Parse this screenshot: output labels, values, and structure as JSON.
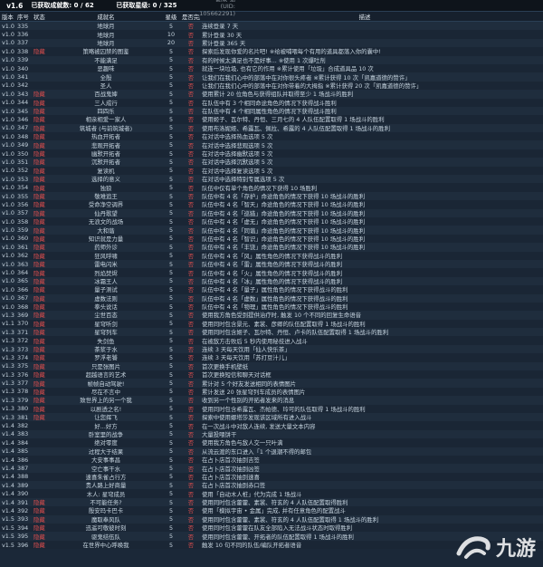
{
  "topbar": {
    "version": "v1.6",
    "achievements_label": "已获取成就数: 0 / 62",
    "stars_label": "已获取星级: 0 / 325",
    "uid": "翻录 猫 (UID: 105662291)"
  },
  "columns": [
    "版本",
    "序号",
    "状态",
    "成就名",
    "星级",
    "是否完成",
    "描述"
  ],
  "rows": [
    {
      "v": "v1.0",
      "n": "335",
      "s": "",
      "name": "地球月",
      "star": "5",
      "done": "否",
      "desc": "连续登录 7 天"
    },
    {
      "v": "v1.0",
      "n": "336",
      "s": "",
      "name": "地球月",
      "star": "10",
      "done": "否",
      "desc": "累计登录 30 天"
    },
    {
      "v": "v1.0",
      "n": "337",
      "s": "",
      "name": "地球月",
      "star": "20",
      "done": "否",
      "desc": "累计登录 365 天"
    },
    {
      "v": "v1.0",
      "n": "338",
      "s": "隐藏",
      "name": "策略被囚禁的图鉴",
      "star": "5",
      "done": "否",
      "desc": "探索后发现你爱的名片吧! ※给被哺喂每个有用的道具都落入你的囊中!"
    },
    {
      "v": "v1.0",
      "n": "339",
      "s": "",
      "name": "不能满足",
      "star": "5",
      "done": "否",
      "desc": "有的时候太满足也不是好事... ※使用 1 次爆吐剂"
    },
    {
      "v": "v1.0",
      "n": "340",
      "s": "",
      "name": "恶趣味",
      "star": "5",
      "done": "否",
      "desc": "就连一块垃圾, 也有它的作用 ※累计使用「垃圾」合成道具品 10 次"
    },
    {
      "v": "v1.0",
      "n": "341",
      "s": "",
      "name": "全殷",
      "star": "5",
      "done": "否",
      "desc": "让我们在我们心中的部落中在对你很头疼者 ※累计获得 10 次「凯嘉道德的赞许」"
    },
    {
      "v": "v1.0",
      "n": "342",
      "s": "",
      "name": "圣人",
      "star": "5",
      "done": "否",
      "desc": "让我们在我们心中的部落中在对你带着的大拇指 ※累计获得 20 次「凯嘉道德的赞许」"
    },
    {
      "v": "v1.0",
      "n": "343",
      "s": "隐藏",
      "name": "百战鬼婶",
      "star": "5",
      "done": "否",
      "desc": "使用累计 20 位角色与获得组队并取得至少 1 场战斗的胜利"
    },
    {
      "v": "v1.0",
      "n": "344",
      "s": "隐藏",
      "name": "三人成行",
      "star": "5",
      "done": "否",
      "desc": "在队伍中有 3 个相同命途角色的情况下获得战斗胜利"
    },
    {
      "v": "v1.0",
      "n": "345",
      "s": "隐藏",
      "name": "四四乐",
      "star": "5",
      "done": "否",
      "desc": "在队伍中有 4 个相同属性角色的情况下获得战斗胜利"
    },
    {
      "v": "v1.0",
      "n": "346",
      "s": "隐藏",
      "name": "相亲相爱一家人",
      "star": "5",
      "done": "否",
      "desc": "使用姬子、瓦尔特、丹恒、三月七的 4 人队伍配置取得 1 场战斗的胜利"
    },
    {
      "v": "v1.0",
      "n": "347",
      "s": "隐藏",
      "name": "筑城者 (与前筑城者)",
      "star": "5",
      "done": "否",
      "desc": "使用布洛妮娅、希露瓦、佩拉、希露的 4 人队伍配置取得 1 场战斗的胜利"
    },
    {
      "v": "v1.0",
      "n": "348",
      "s": "隐藏",
      "name": "热血开拓者",
      "star": "5",
      "done": "否",
      "desc": "在对话中选择热血选项 5 次"
    },
    {
      "v": "v1.0",
      "n": "349",
      "s": "隐藏",
      "name": "悲观开拓者",
      "star": "5",
      "done": "否",
      "desc": "在对话中选择悲观选项 5 次"
    },
    {
      "v": "v1.0",
      "n": "350",
      "s": "隐藏",
      "name": "幽默开拓者",
      "star": "5",
      "done": "否",
      "desc": "在对话中选择幽默选项 5 次"
    },
    {
      "v": "v1.0",
      "n": "351",
      "s": "隐藏",
      "name": "沉默开拓者",
      "star": "5",
      "done": "否",
      "desc": "在对话中选择沉默选项 5 次"
    },
    {
      "v": "v1.0",
      "n": "352",
      "s": "隐藏",
      "name": "复读机",
      "star": "5",
      "done": "否",
      "desc": "在对话中选择复读选项 5 次"
    },
    {
      "v": "v1.0",
      "n": "353",
      "s": "隐藏",
      "name": "选择的意义",
      "star": "5",
      "done": "否",
      "desc": "在对话中选择特别专属选项 5 次"
    },
    {
      "v": "v1.0",
      "n": "354",
      "s": "隐藏",
      "name": "独狼",
      "star": "5",
      "done": "否",
      "desc": "队伍中仅有单个角色的情况下获得 10 场胜利"
    },
    {
      "v": "v1.0",
      "n": "355",
      "s": "隐藏",
      "name": "敬难追王",
      "star": "5",
      "done": "否",
      "desc": "队伍中有 4 名「存护」命途角色的情况下获得 10 场战斗的胜利"
    },
    {
      "v": "v1.0",
      "n": "356",
      "s": "隐藏",
      "name": "受命净空调界",
      "star": "5",
      "done": "否",
      "desc": "队伍中有 4 名「智天」命途角色的情况下获得 10 场战斗的胜利"
    },
    {
      "v": "v1.0",
      "n": "357",
      "s": "隐藏",
      "name": "仙丹歌望",
      "star": "5",
      "done": "否",
      "desc": "队伍中有 4 名「巡猎」命途角色的情况下获得 10 场战斗的胜利"
    },
    {
      "v": "v1.0",
      "n": "358",
      "s": "隐藏",
      "name": "无浪文的战场",
      "star": "5",
      "done": "否",
      "desc": "队伍中有 4 名「虚无」命途角色的情况下获得 10 场战斗的胜利"
    },
    {
      "v": "v1.0",
      "n": "359",
      "s": "隐藏",
      "name": "大和谐",
      "star": "5",
      "done": "否",
      "desc": "队伍中有 4 名「同谐」命途角色的情况下获得 10 场战斗的胜利"
    },
    {
      "v": "v1.0",
      "n": "360",
      "s": "隐藏",
      "name": "知识就是力量",
      "star": "5",
      "done": "否",
      "desc": "队伍中有 4 名「智识」命途角色的情况下获得 10 场战斗的胜利"
    },
    {
      "v": "v1.0",
      "n": "361",
      "s": "隐藏",
      "name": "药师外诊",
      "star": "5",
      "done": "否",
      "desc": "队伍中有 4 名「丰饶」命途角色的情况下获得 10 场战斗的胜利"
    },
    {
      "v": "v1.0",
      "n": "362",
      "s": "隐藏",
      "name": "狂风呼啸",
      "star": "5",
      "done": "否",
      "desc": "队伍中有 4 名「风」属性角色的情况下获得战斗的胜利"
    },
    {
      "v": "v1.0",
      "n": "363",
      "s": "隐藏",
      "name": "雷电闪米",
      "star": "5",
      "done": "否",
      "desc": "队伍中有 4 名「雷」属性角色的情况下获得战斗的胜利"
    },
    {
      "v": "v1.0",
      "n": "364",
      "s": "隐藏",
      "name": "烈焰焚烬",
      "star": "5",
      "done": "否",
      "desc": "队伍中有 4 名「火」属性角色的情况下获得战斗的胜利"
    },
    {
      "v": "v1.0",
      "n": "365",
      "s": "隐藏",
      "name": "冰霜王人",
      "star": "5",
      "done": "否",
      "desc": "队伍中有 4 名「冰」属性角色的情况下获得战斗的胜利"
    },
    {
      "v": "v1.0",
      "n": "366",
      "s": "隐藏",
      "name": "量子测试",
      "star": "5",
      "done": "否",
      "desc": "队伍中有 4 名「量子」属性角色的情况下获得战斗的胜利"
    },
    {
      "v": "v1.0",
      "n": "367",
      "s": "隐藏",
      "name": "虚数法则",
      "star": "5",
      "done": "否",
      "desc": "队伍中有 4 名「虚数」属性角色的情况下获得战斗的胜利"
    },
    {
      "v": "v1.0",
      "n": "368",
      "s": "隐藏",
      "name": "拳头说话",
      "star": "5",
      "done": "否",
      "desc": "队伍中有 4 名「物理」属性角色的情况下获得战斗的胜利"
    },
    {
      "v": "v1.3",
      "n": "369",
      "s": "隐藏",
      "name": "尘世百态",
      "star": "5",
      "done": "否",
      "desc": "使用我方角色受到提供治疗时, 触发 10 个不同的回复生命语音"
    },
    {
      "v": "v1.1",
      "n": "370",
      "s": "隐藏",
      "name": "星穹听剑",
      "star": "5",
      "done": "否",
      "desc": "使用同时包含景元、素裳、彦卿的队伍配置取得 1 场战斗的胜利"
    },
    {
      "v": "v1.3",
      "n": "371",
      "s": "隐藏",
      "name": "星穹列车",
      "star": "5",
      "done": "否",
      "desc": "使用同时包含姬子、瓦尔特、丹恒、卢卡的队伍配置取得 1 场战斗的胜利"
    },
    {
      "v": "v1.3",
      "n": "372",
      "s": "隐藏",
      "name": "失剑鱼",
      "star": "5",
      "done": "否",
      "desc": "在被敌方击败后 5 秒内使用秘技进入战斗"
    },
    {
      "v": "v1.3",
      "n": "373",
      "s": "隐藏",
      "name": "茶浆于水",
      "star": "5",
      "done": "否",
      "desc": "连续 3 天每天饮用「仙人快乐茶」"
    },
    {
      "v": "v1.3",
      "n": "374",
      "s": "隐藏",
      "name": "罗浮老饕",
      "star": "5",
      "done": "否",
      "desc": "连续 3 天每天饮用「苏打豆汁儿」"
    },
    {
      "v": "v1.3",
      "n": "375",
      "s": "隐藏",
      "name": "只是张图片",
      "star": "5",
      "done": "否",
      "desc": "首次更换手机壁纸"
    },
    {
      "v": "v1.3",
      "n": "376",
      "s": "隐藏",
      "name": "超越语言的艺术",
      "star": "5",
      "done": "否",
      "desc": "首次更换短信和聊天对话框"
    },
    {
      "v": "v1.3",
      "n": "377",
      "s": "隐藏",
      "name": "帧帧自动驾驶!",
      "star": "5",
      "done": "否",
      "desc": "累计对 5 个好友发送相同的表情图片"
    },
    {
      "v": "v1.3",
      "n": "378",
      "s": "隐藏",
      "name": "尽在不言中",
      "star": "5",
      "done": "否",
      "desc": "累计发送 20 张星穹列车成员的表情图片"
    },
    {
      "v": "v1.3",
      "n": "379",
      "s": "隐藏",
      "name": "致世界上的另一个我",
      "star": "5",
      "done": "否",
      "desc": "收到另一个性别的开拓者发来的消息"
    },
    {
      "v": "v1.3",
      "n": "380",
      "s": "隐藏",
      "name": "以剧透之名!",
      "star": "5",
      "done": "否",
      "desc": "使用同时包含希露瓦、杰帕德、玲可的队伍取得 1 场战斗的胜利"
    },
    {
      "v": "v1.3",
      "n": "381",
      "s": "隐藏",
      "name": "让您挥飞",
      "star": "5",
      "done": "否",
      "desc": "探索中使用娜塔莎发现该区域所有进入战斗"
    },
    {
      "v": "v1.4",
      "n": "382",
      "s": "",
      "name": "好...好方",
      "star": "5",
      "done": "否",
      "desc": "在一次战斗中对敌人连续, 发送大量文本内容"
    },
    {
      "v": "v1.4",
      "n": "383",
      "s": "",
      "name": "卧室里的战争",
      "star": "5",
      "done": "否",
      "desc": "大量投喂饼干"
    },
    {
      "v": "v1.4",
      "n": "384",
      "s": "",
      "name": "绝对零度",
      "star": "5",
      "done": "否",
      "desc": "使用我方角色与敌人交一只叶满"
    },
    {
      "v": "v1.4",
      "n": "385",
      "s": "",
      "name": "过程大于结果",
      "star": "5",
      "done": "否",
      "desc": "从流云渡的东口进入「1 个退潮不得的邮包"
    },
    {
      "v": "v1.4",
      "n": "386",
      "s": "",
      "name": "大安事事昌",
      "star": "5",
      "done": "否",
      "desc": "在占卜店首次抽到吉签"
    },
    {
      "v": "v1.4",
      "n": "387",
      "s": "",
      "name": "空亡事干水",
      "star": "5",
      "done": "否",
      "desc": "在占卜店首次抽到凶签"
    },
    {
      "v": "v1.4",
      "n": "388",
      "s": "",
      "name": "速喜朱雀占行方",
      "star": "5",
      "done": "否",
      "desc": "在占卜店首次抽到速喜"
    },
    {
      "v": "v1.4",
      "n": "389",
      "s": "",
      "name": "贵人路上好商量",
      "star": "5",
      "done": "否",
      "desc": "在占卜店首次抽到赤口签"
    },
    {
      "v": "v1.4",
      "n": "390",
      "s": "",
      "name": "木人: 星穹成员",
      "star": "5",
      "done": "否",
      "desc": "使用「自动木人桩」代为完成 1 场战斗"
    },
    {
      "v": "v1.4",
      "n": "391",
      "s": "隐藏",
      "name": "不可能任务?",
      "star": "5",
      "done": "否",
      "desc": "使用同时包含藿藿、素裳、符玄的 4 人队伍配置取得胜利"
    },
    {
      "v": "v1.4",
      "n": "392",
      "s": "隐藏",
      "name": "殷安玛卡巴卡",
      "star": "5",
      "done": "否",
      "desc": "使用「模拟宇宙 • 金属」完成, 并有任意角色的配置战斗"
    },
    {
      "v": "v1.5",
      "n": "393",
      "s": "隐藏",
      "name": "魔取奉风队",
      "star": "5",
      "done": "否",
      "desc": "使用同时包含藿藿、素裳、符玄的 4 人队伍配置取得 1 场战斗的胜利"
    },
    {
      "v": "v1.5",
      "n": "394",
      "s": "隐藏",
      "name": "迅遥可敬彼时刻",
      "star": "5",
      "done": "否",
      "desc": "使用同时包含藿藿在队友全部陷入无法战斗状态时取得胜利"
    },
    {
      "v": "v1.5",
      "n": "395",
      "s": "隐藏",
      "name": "驱鬼结伍队",
      "star": "5",
      "done": "否",
      "desc": "使用同时包含藿藿、开拓者的队伍配置取得 1 场战斗的胜利"
    },
    {
      "v": "v1.5",
      "n": "396",
      "s": "隐藏",
      "name": "在世界中心呼唤我",
      "star": "5",
      "done": "否",
      "desc": "触发 10 句不同的队伍/编队开拓者语音"
    }
  ],
  "watermark": {
    "text": "九游"
  }
}
